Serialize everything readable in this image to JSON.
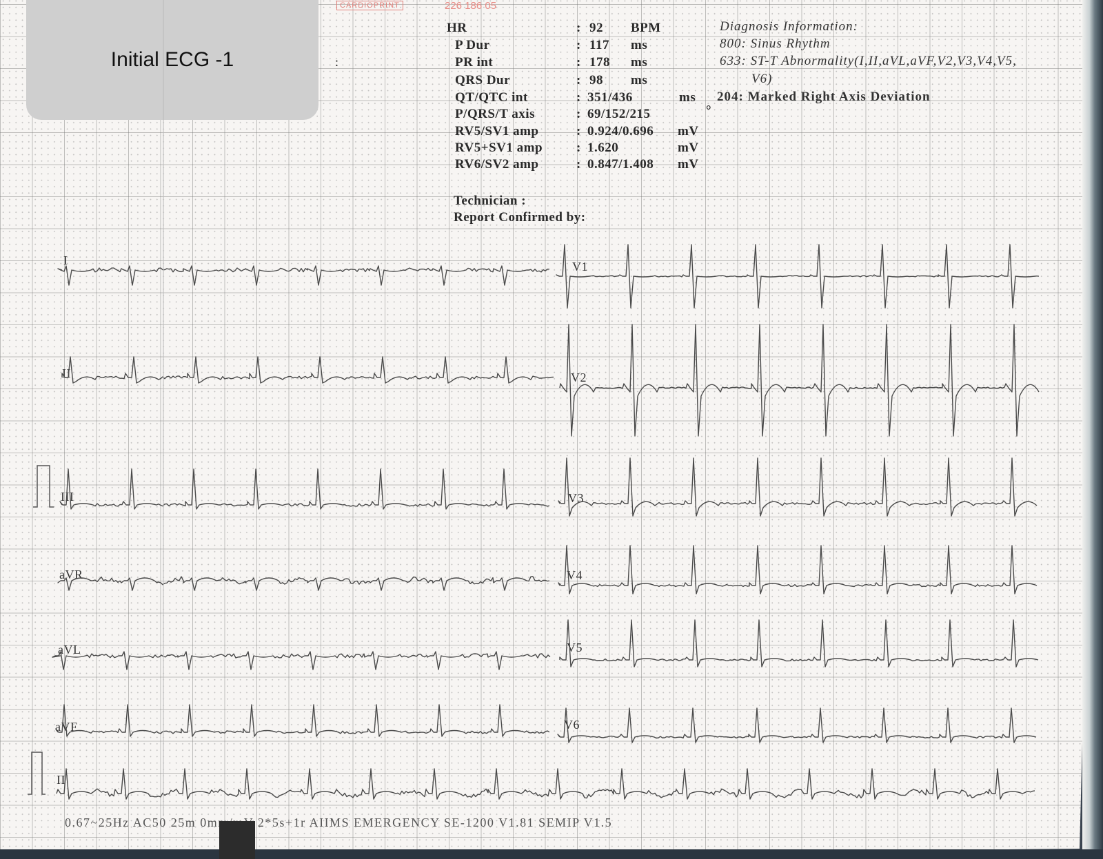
{
  "panel_label": "Initial ECG -1",
  "brand": "CARDIOPRINT",
  "serial": "226 186 05",
  "measurements": [
    {
      "name": "HR",
      "value": "92",
      "unit": "BPM"
    },
    {
      "name": "P  Dur",
      "value": "117",
      "unit": "ms"
    },
    {
      "name": "PR  int",
      "value": "178",
      "unit": "ms"
    },
    {
      "name": "QRS  Dur",
      "value": "98",
      "unit": "ms"
    },
    {
      "name": "QT/QTC  int",
      "value": "351/436",
      "unit": "ms"
    },
    {
      "name": "P/QRS/T  axis",
      "value": "69/152/215",
      "unit": "°"
    },
    {
      "name": "RV5/SV1  amp",
      "value": "0.924/0.696",
      "unit": "mV"
    },
    {
      "name": "RV5+SV1  amp",
      "value": "1.620",
      "unit": "mV"
    },
    {
      "name": "RV6/SV2  amp",
      "value": "0.847/1.408",
      "unit": "mV"
    }
  ],
  "technician_label": "Technician  :",
  "confirmed_label": "Report  Confirmed  by:",
  "diagnosis": {
    "title": "Diagnosis  Information:",
    "lines": [
      "800:  Sinus  Rhythm",
      "633:  ST-T  Abnormality(I,II,aVL,aVF,V2,V3,V4,V5,",
      "V6)",
      "204:  Marked  Right  Axis  Deviation"
    ]
  },
  "leads": {
    "left": [
      "I",
      "II",
      "III",
      "aVR",
      "aVL",
      "aVF",
      "II"
    ],
    "right": [
      "V1",
      "V2",
      "V3",
      "V4",
      "V5",
      "V6"
    ]
  },
  "footer_text": "0.67~25Hz  AC50  25m        0mm/mV  2*5s+1r  AIIMS  EMERGENCY    SE-1200    V1.81    SEMIP  V1.5"
}
